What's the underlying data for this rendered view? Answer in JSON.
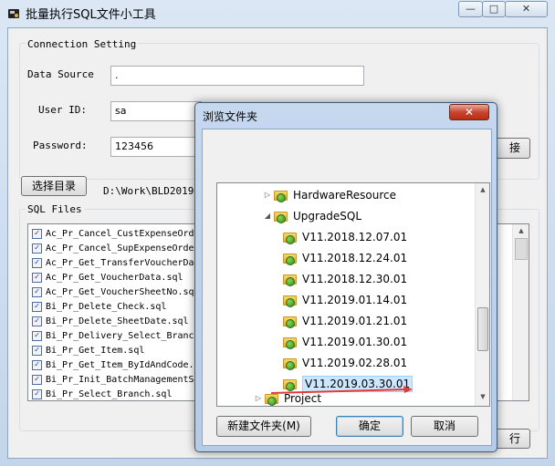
{
  "main": {
    "title": "批量执行SQL文件小工具",
    "connection_group": "Connection Setting",
    "data_source_label": "Data Source",
    "data_source_value": ".",
    "user_id_label": "User ID:",
    "user_id_value": "sa",
    "password_label": "Password:",
    "password_value": "123456",
    "connect_button_partial": "接",
    "choose_dir_button": "选择目录",
    "dir_path": "D:\\Work\\BLD2019\\",
    "sql_group": "SQL Files",
    "run_button_partial": "行",
    "files": [
      "Ac_Pr_Cancel_CustExpenseOrd",
      "Ac_Pr_Cancel_SupExpenseOrde",
      "Ac_Pr_Get_TransferVoucherDa",
      "Ac_Pr_Get_VoucherData.sql",
      "Ac_Pr_Get_VoucherSheetNo.sql",
      "Bi_Pr_Delete_Check.sql",
      "Bi_Pr_Delete_SheetDate.sql",
      "Bi_Pr_Delivery_Select_Branc",
      "Bi_Pr_Get_Item.sql",
      "Bi_Pr_Get_Item_ByIdAndCode.",
      "Bi_Pr_Init_BatchManagementS",
      "Bi_Pr_Select_Branch.sql"
    ]
  },
  "dialog": {
    "title": "浏览文件夹",
    "close_icon": "x-icon",
    "tree": {
      "parent_1": "HardwareResource",
      "parent_2": "UpgradeSQL",
      "children": [
        "V11.2018.12.07.01",
        "V11.2018.12.24.01",
        "V11.2018.12.30.01",
        "V11.2019.01.14.01",
        "V11.2019.01.21.01",
        "V11.2019.01.30.01",
        "V11.2019.02.28.01",
        "V11.2019.03.30.01"
      ],
      "partial_next": "Project"
    },
    "new_folder_button": "新建文件夹(M)",
    "ok_button": "确定",
    "cancel_button": "取消"
  },
  "colors": {
    "accent_arrow": "#e23b3b",
    "selection": "#cce8ff"
  }
}
